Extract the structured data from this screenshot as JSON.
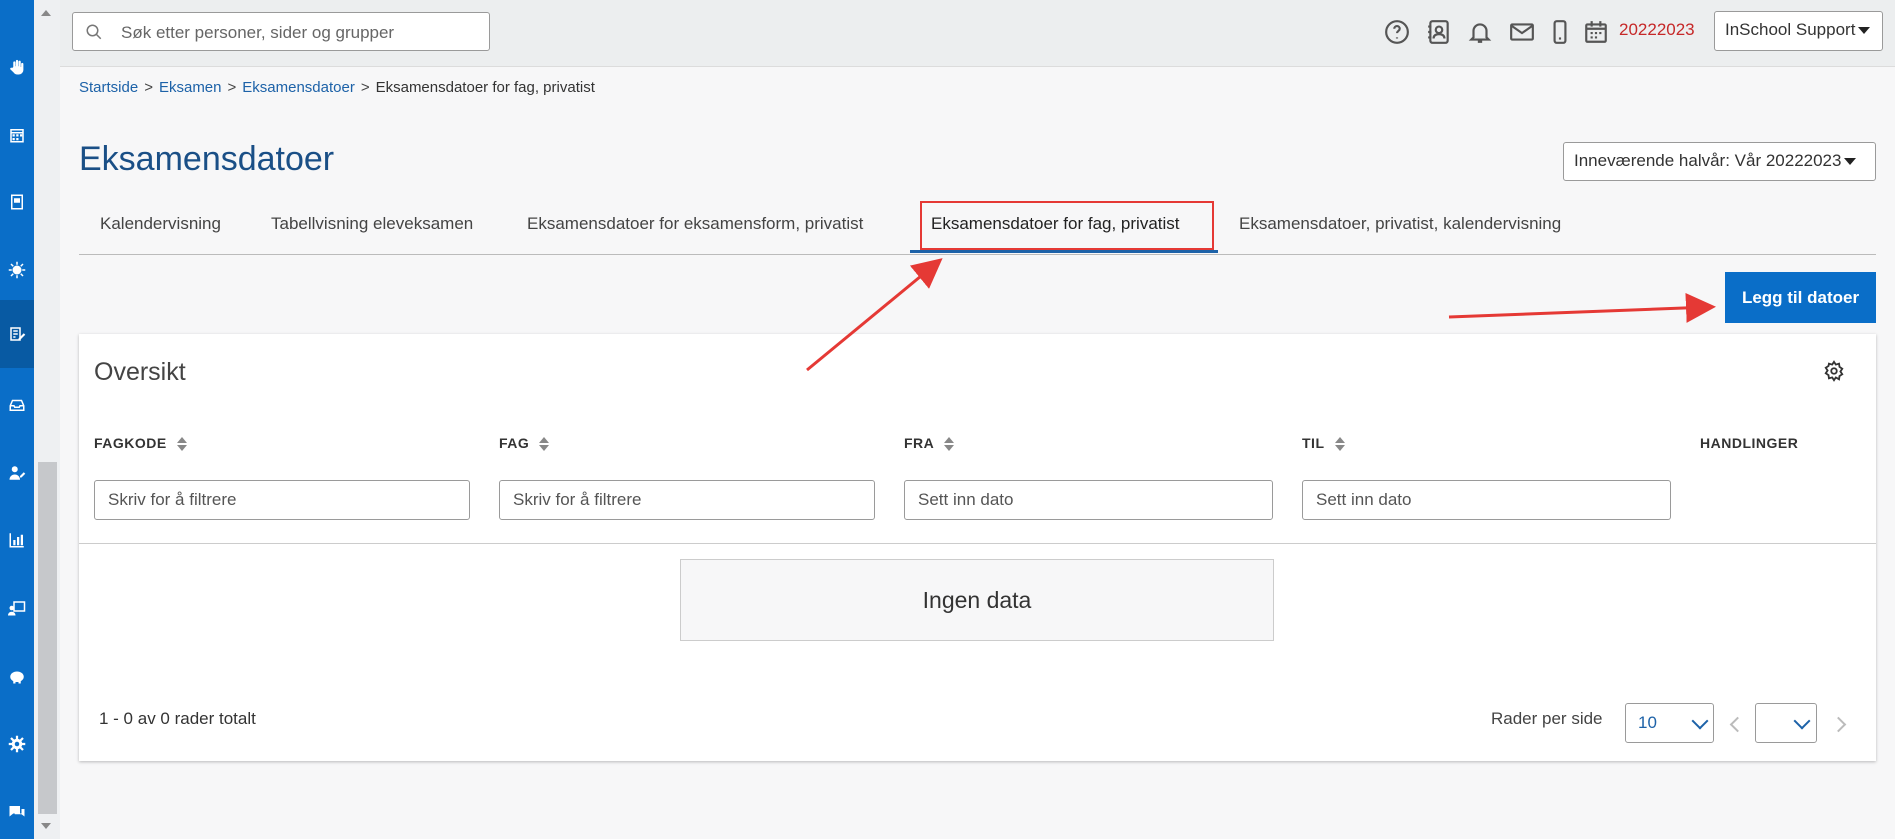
{
  "sidebar": {
    "items": [
      {
        "icon": "hand-icon"
      },
      {
        "icon": "calendar-icon"
      },
      {
        "icon": "book-icon"
      },
      {
        "icon": "sun-icon"
      },
      {
        "icon": "exam-edit-icon",
        "active": true
      },
      {
        "icon": "inbox-icon"
      },
      {
        "icon": "user-edit-icon"
      },
      {
        "icon": "chart-icon"
      },
      {
        "icon": "teacher-board-icon"
      },
      {
        "icon": "piggy-bank-icon"
      },
      {
        "icon": "gear-icon"
      },
      {
        "icon": "chat-icon"
      }
    ]
  },
  "topbar": {
    "search_placeholder": "Søk etter personer, sider og grupper",
    "icons": [
      "help-icon",
      "contacts-icon",
      "bell-icon",
      "mail-icon",
      "phone-icon",
      "calendar-icon"
    ],
    "year": "20222023",
    "user_menu": "InSchool Support"
  },
  "breadcrumb": {
    "items": [
      "Startside",
      "Eksamen",
      "Eksamensdatoer"
    ],
    "current": "Eksamensdatoer for fag, privatist"
  },
  "page": {
    "title": "Eksamensdatoer",
    "term_select": "Inneværende halvår: Vår 20222023"
  },
  "tabs": [
    {
      "label": "Kalendervisning"
    },
    {
      "label": "Tabellvisning eleveksamen"
    },
    {
      "label": "Eksamensdatoer for eksamensform, privatist"
    },
    {
      "label": "Eksamensdatoer for fag, privatist",
      "active": true
    },
    {
      "label": "Eksamensdatoer, privatist, kalendervisning"
    }
  ],
  "actions": {
    "add_dates": "Legg til datoer"
  },
  "overview": {
    "title": "Oversikt",
    "columns": [
      "FAGKODE",
      "FAG",
      "FRA",
      "TIL",
      "HANDLINGER"
    ],
    "filters": {
      "fagkode": "Skriv for å filtrere",
      "fag": "Skriv for å filtrere",
      "fra": "Sett inn dato",
      "til": "Sett inn dato"
    },
    "empty_text": "Ingen data",
    "total_text": "1 - 0 av 0 rader totalt",
    "rows_per_page_label": "Rader per side",
    "rows_per_page": "10"
  },
  "annotation_color": "#e53935"
}
